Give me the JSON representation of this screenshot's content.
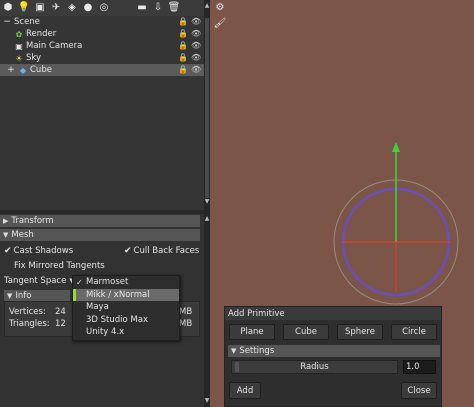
{
  "toolbar": {
    "icons": [
      "object-icon",
      "light-icon",
      "camera-icon",
      "curve-icon",
      "mesh-icon",
      "sphere-icon",
      "material-icon",
      "open-folder-icon",
      "import-icon",
      "delete-icon",
      "settings-icon"
    ]
  },
  "scene": {
    "root": "Scene",
    "items": [
      {
        "label": "Render"
      },
      {
        "label": "Main Camera"
      },
      {
        "label": "Sky"
      },
      {
        "label": "Cube",
        "selected": true
      }
    ]
  },
  "sections": {
    "transform": "Transform",
    "mesh": "Mesh"
  },
  "mesh": {
    "cast_shadows": "Cast Shadows",
    "cull_back_faces": "Cull Back Faces",
    "fix_mirrored_tangents": "Fix Mirrored Tangents",
    "tangent_space_label": "Tangent Space"
  },
  "info": {
    "title": "Info",
    "vertices_label": "Vertices:",
    "vertices_value": "24",
    "triangles_label": "Triangles:",
    "triangles_value": "12",
    "mem_unit_1": "MB",
    "mem_unit_2": "MB"
  },
  "dropdown": {
    "options": [
      "Marmoset",
      "Mikk / xNormal",
      "Maya",
      "3D Studio Max",
      "Unity 4.x"
    ],
    "checked": "Marmoset",
    "hover": "Mikk / xNormal"
  },
  "add_primitive": {
    "title": "Add Primitive",
    "buttons": [
      "Plane",
      "Cube",
      "Sphere",
      "Circle"
    ],
    "settings": "Settings",
    "radius_label": "Radius",
    "radius_value": "1.0",
    "add": "Add",
    "close": "Close"
  },
  "colors": {
    "viewport_bg": "#7a5548",
    "axis_x": "#e04030",
    "axis_y": "#40d040",
    "gizmo_circle": "#6b4fb8",
    "selection_accent": "#9ed92a"
  }
}
